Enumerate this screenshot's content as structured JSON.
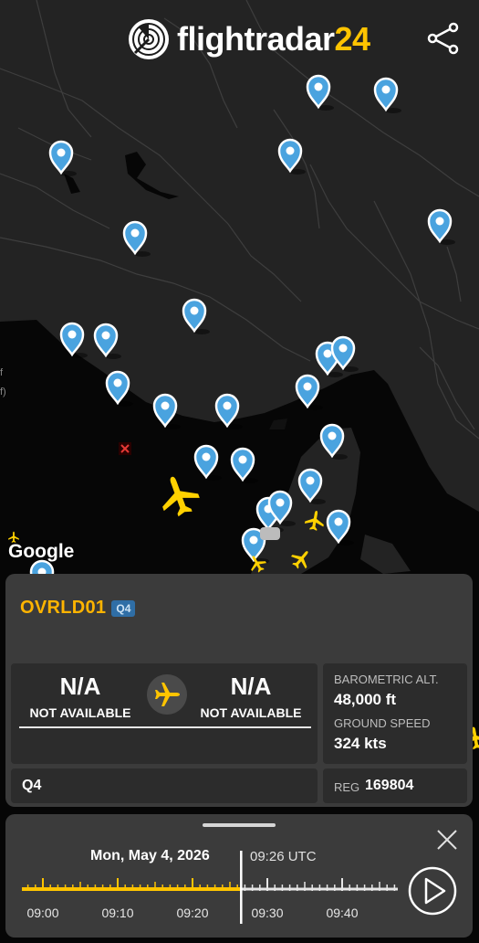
{
  "app": {
    "logo_text": "flightradar",
    "logo_number": "24",
    "google_watermark": "Google",
    "edge_label_1": "f",
    "edge_label_2": "f)"
  },
  "colors": {
    "accent": "#ffb400",
    "map_background": "#1b1b1b",
    "water": "#050505",
    "marker": "#4aa3df",
    "panel": "#3b3b3b",
    "badge": "#2f6ea6"
  },
  "icons": {
    "share": "share-icon",
    "marker": "map-pin-icon",
    "plane": "airplane-icon",
    "close": "close-icon",
    "play": "play-icon"
  },
  "flight": {
    "callsign": "OVRLD01",
    "badge": "Q4",
    "origin_code": "N/A",
    "origin_status": "NOT AVAILABLE",
    "destination_code": "N/A",
    "destination_status": "NOT AVAILABLE",
    "altitude_label": "BAROMETRIC ALT.",
    "altitude_value": "48,000 ft",
    "speed_label": "GROUND SPEED",
    "speed_value": "324 kts",
    "aircraft_type": "Q4",
    "reg_label": "REG",
    "reg_value": "169804"
  },
  "playback": {
    "date": "Mon, May 4, 2026",
    "time": "09:26 UTC",
    "ticks": [
      "09:00",
      "09:10",
      "09:20",
      "09:30",
      "09:40"
    ],
    "progress_minutes": 26.5,
    "range_minutes": [
      0,
      50
    ]
  }
}
